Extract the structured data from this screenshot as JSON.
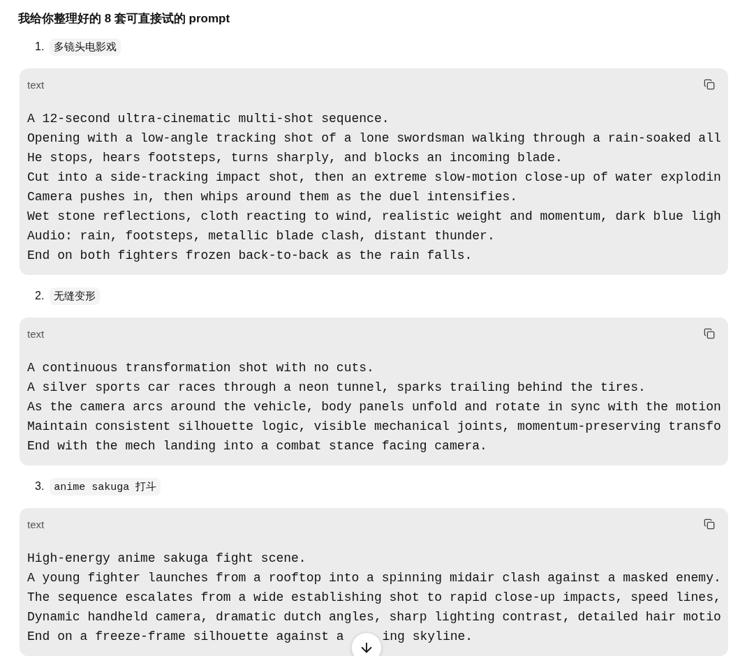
{
  "heading": "我给你整理好的 8 套可直接试的 prompt",
  "prompts": [
    {
      "number": "1.",
      "label": "多镜头电影戏",
      "code": {
        "language": "text",
        "lines": [
          "A 12-second ultra-cinematic multi-shot sequence.",
          "Opening with a low-angle tracking shot of a lone swordsman walking through a rain-soaked all",
          "He stops, hears footsteps, turns sharply, and blocks an incoming blade.",
          "Cut into a side-tracking impact shot, then an extreme slow-motion close-up of water explodin",
          "Camera pushes in, then whips around them as the duel intensifies.",
          "Wet stone reflections, cloth reacting to wind, realistic weight and momentum, dark blue ligh",
          "Audio: rain, footsteps, metallic blade clash, distant thunder.",
          "End on both fighters frozen back-to-back as the rain falls."
        ]
      }
    },
    {
      "number": "2.",
      "label": "无缝变形",
      "code": {
        "language": "text",
        "lines": [
          "A continuous transformation shot with no cuts.",
          "A silver sports car races through a neon tunnel, sparks trailing behind the tires.",
          "As the camera arcs around the vehicle, body panels unfold and rotate in sync with the motion",
          "Maintain consistent silhouette logic, visible mechanical joints, momentum-preserving transfo",
          "End with the mech landing into a combat stance facing camera."
        ]
      }
    },
    {
      "number": "3.",
      "label": "anime sakuga 打斗",
      "code": {
        "language": "text",
        "lines": [
          "High-energy anime sakuga fight scene.",
          "A young fighter launches from a rooftop into a spinning midair clash against a masked enemy.",
          "The sequence escalates from a wide establishing shot to rapid close-up impacts, speed lines,",
          "Dynamic handheld camera, dramatic dutch angles, sharp lighting contrast, detailed hair motio",
          {
            "segments": [
              "End on a freeze-frame silhouette against a",
              "ing skyline."
            ]
          }
        ]
      }
    }
  ]
}
